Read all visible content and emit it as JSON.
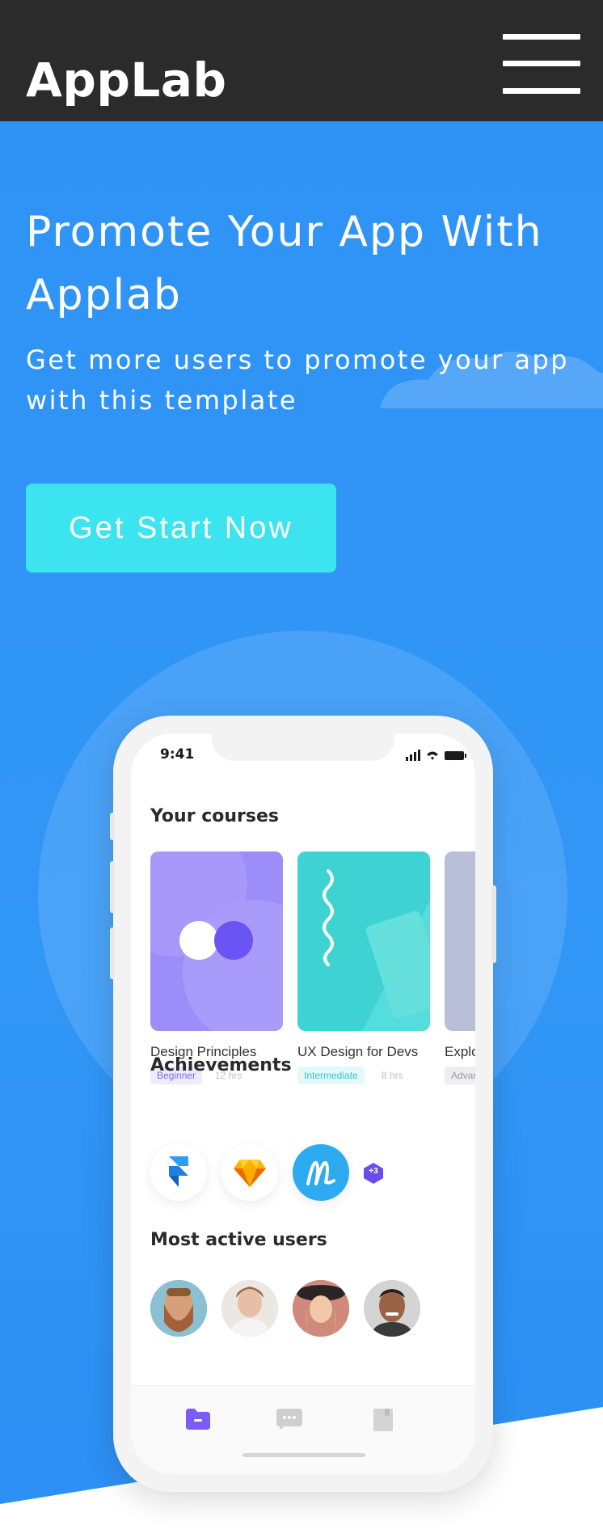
{
  "header": {
    "brand": "AppLab",
    "menu_icon": "hamburger-icon"
  },
  "hero": {
    "title": "Promote Your App With Applab",
    "subtitle": "Get more users to promote your app with this template",
    "cta_label": "Get Start Now"
  },
  "colors": {
    "header_bg": "#2b2b2b",
    "hero_bg": "#3197f6",
    "cta_bg": "#3ce4ef",
    "purple": "#7b6cf6",
    "teal": "#3ccfcf"
  },
  "phone": {
    "status_time": "9:41",
    "courses_title": "Your courses",
    "courses": [
      {
        "name": "Design Principles",
        "level": "Beginner",
        "hours": "12 hrs"
      },
      {
        "name": "UX Design for Devs",
        "level": "Intermediate",
        "hours": "8 hrs"
      },
      {
        "name": "Explor",
        "level": "Advar",
        "hours": ""
      }
    ],
    "achievements_title": "Achievements",
    "achievements": [
      "framer-icon",
      "sketch-icon",
      "marvel-icon"
    ],
    "achievements_more": "+3",
    "users_title": "Most active users",
    "users": [
      "avatar-1",
      "avatar-2",
      "avatar-3",
      "avatar-4"
    ],
    "tabs": [
      "folder-icon",
      "chat-icon",
      "book-icon"
    ]
  }
}
